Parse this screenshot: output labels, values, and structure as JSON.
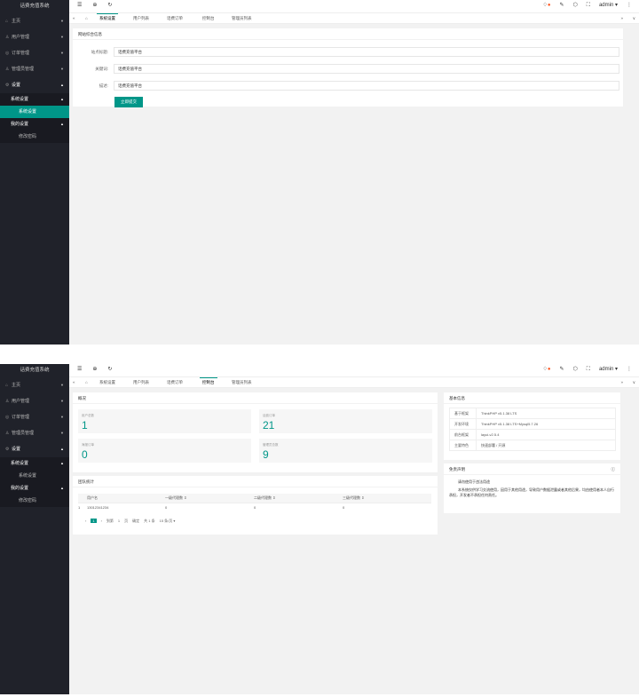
{
  "app_title": "话费充值系统",
  "menu": {
    "home": "主页",
    "user_mgmt": "用户管理",
    "order_mgmt": "订单管理",
    "admin_mgmt": "管理员管理",
    "settings": "设置",
    "system_settings": "系统设置",
    "website_settings": "系统设置",
    "my_settings": "我的设置",
    "change_pwd": "修改密码"
  },
  "topbar": {
    "admin": "admin ▾"
  },
  "tabs": [
    "系统设置",
    "用户列表",
    "话费订单",
    "控制台",
    "管理员列表"
  ],
  "shot1": {
    "card_title": "网站综合信息",
    "fields": [
      {
        "label": "站点标题:",
        "value": "话费充值平台"
      },
      {
        "label": "关键词:",
        "value": "话费充值平台"
      },
      {
        "label": "描述:",
        "value": "话费充值平台"
      }
    ],
    "submit": "立即提交"
  },
  "shot2": {
    "overview_title": "概况",
    "stats": [
      {
        "label": "用户总数",
        "value": "1"
      },
      {
        "label": "话费订单",
        "value": "21"
      },
      {
        "label": "海报订单",
        "value": "0"
      },
      {
        "label": "管理员总数",
        "value": "9"
      }
    ],
    "fenxiao_title": "团队统计",
    "table_headers": [
      "用户名",
      "一级代理数 ⇕",
      "二级代理数 ⇕",
      "三级代理数 ⇕"
    ],
    "table_rows": [
      {
        "idx": "1",
        "user": "13012341234",
        "l1": "0",
        "l2": "0",
        "l3": "0"
      }
    ],
    "pager": {
      "prev": "‹",
      "page": "1",
      "next": "›",
      "goto": "到第",
      "input": "1",
      "ye": "页",
      "ok": "确定",
      "total": "共 1 条",
      "size": "15 条/页 ▾"
    },
    "basic_title": "基本信息",
    "basic": [
      {
        "k": "基于框架",
        "v": "ThinkPHP v5.1.38 LTS"
      },
      {
        "k": "开发环境",
        "v": "ThinkPHP v5.1.38 LTS+Mysql5.7.26"
      },
      {
        "k": "前台框架",
        "v": "layui-v2.5.4"
      },
      {
        "k": "主要特色",
        "v": "快速部署 / 开源"
      }
    ],
    "notice_title": "免责声明",
    "notice_p1": "请勿使用于违法用途",
    "notice_p2": "本系统仅供学习交流使用，因用于其他用途，导致用户数据泄露或者其他后果，均由使用者本人自行承担，开发者不承担任何责任。"
  }
}
